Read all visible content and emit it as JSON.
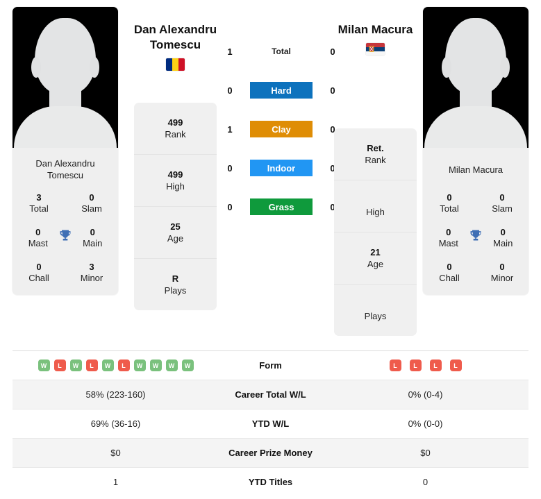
{
  "players": {
    "left": {
      "name": "Dan Alexandru Tomescu",
      "name_line1": "Dan Alexandru",
      "name_line2": "Tomescu",
      "photo_name": "Dan Alexandru Tomescu",
      "flag": "romania-flag",
      "titles": {
        "total_val": "3",
        "total_lbl": "Total",
        "slam_val": "0",
        "slam_lbl": "Slam",
        "mast_val": "0",
        "mast_lbl": "Mast",
        "main_val": "0",
        "main_lbl": "Main",
        "chall_val": "0",
        "chall_lbl": "Chall",
        "minor_val": "3",
        "minor_lbl": "Minor"
      },
      "info": {
        "rank_val": "499",
        "rank_lbl": "Rank",
        "high_val": "499",
        "high_lbl": "High",
        "age_val": "25",
        "age_lbl": "Age",
        "plays_val": "R",
        "plays_lbl": "Plays"
      }
    },
    "right": {
      "name": "Milan Macura",
      "name_line1": "Milan Macura",
      "name_line2": "",
      "photo_name": "Milan Macura",
      "flag": "serbia-flag",
      "titles": {
        "total_val": "0",
        "total_lbl": "Total",
        "slam_val": "0",
        "slam_lbl": "Slam",
        "mast_val": "0",
        "mast_lbl": "Mast",
        "main_val": "0",
        "main_lbl": "Main",
        "chall_val": "0",
        "chall_lbl": "Chall",
        "minor_val": "0",
        "minor_lbl": "Minor"
      },
      "info": {
        "rank_val": "Ret.",
        "rank_lbl": "Rank",
        "high_val": "",
        "high_lbl": "High",
        "age_val": "21",
        "age_lbl": "Age",
        "plays_val": "",
        "plays_lbl": "Plays"
      }
    }
  },
  "h2h": {
    "rows": [
      {
        "label": "Total",
        "left": "1",
        "right": "0",
        "color": "",
        "plain": true
      },
      {
        "label": "Hard",
        "left": "0",
        "right": "0",
        "color": "#0d72bd",
        "plain": false
      },
      {
        "label": "Clay",
        "left": "1",
        "right": "0",
        "color": "#df8d05",
        "plain": false
      },
      {
        "label": "Indoor",
        "left": "0",
        "right": "0",
        "color": "#2196f3",
        "plain": false
      },
      {
        "label": "Grass",
        "left": "0",
        "right": "0",
        "color": "#0f9a3c",
        "plain": false
      }
    ]
  },
  "stats_table": {
    "rows": [
      {
        "label": "Form",
        "type": "form",
        "left_form": [
          "W",
          "L",
          "W",
          "L",
          "W",
          "L",
          "W",
          "W",
          "W",
          "W"
        ],
        "right_form": [
          "L",
          "L",
          "L",
          "L"
        ],
        "left": "",
        "right": ""
      },
      {
        "label": "Career Total W/L",
        "type": "text",
        "left": "58% (223-160)",
        "right": "0% (0-4)"
      },
      {
        "label": "YTD W/L",
        "type": "text",
        "left": "69% (36-16)",
        "right": "0% (0-0)"
      },
      {
        "label": "Career Prize Money",
        "type": "text",
        "left": "$0",
        "right": "$0"
      },
      {
        "label": "YTD Titles",
        "type": "text",
        "left": "1",
        "right": "0"
      }
    ]
  },
  "colors": {
    "hard": "#0d72bd",
    "clay": "#df8d05",
    "indoor": "#2196f3",
    "grass": "#0f9a3c",
    "win": "#7ac17d",
    "loss": "#ef5b4c",
    "trophy": "#3f6fb5"
  }
}
